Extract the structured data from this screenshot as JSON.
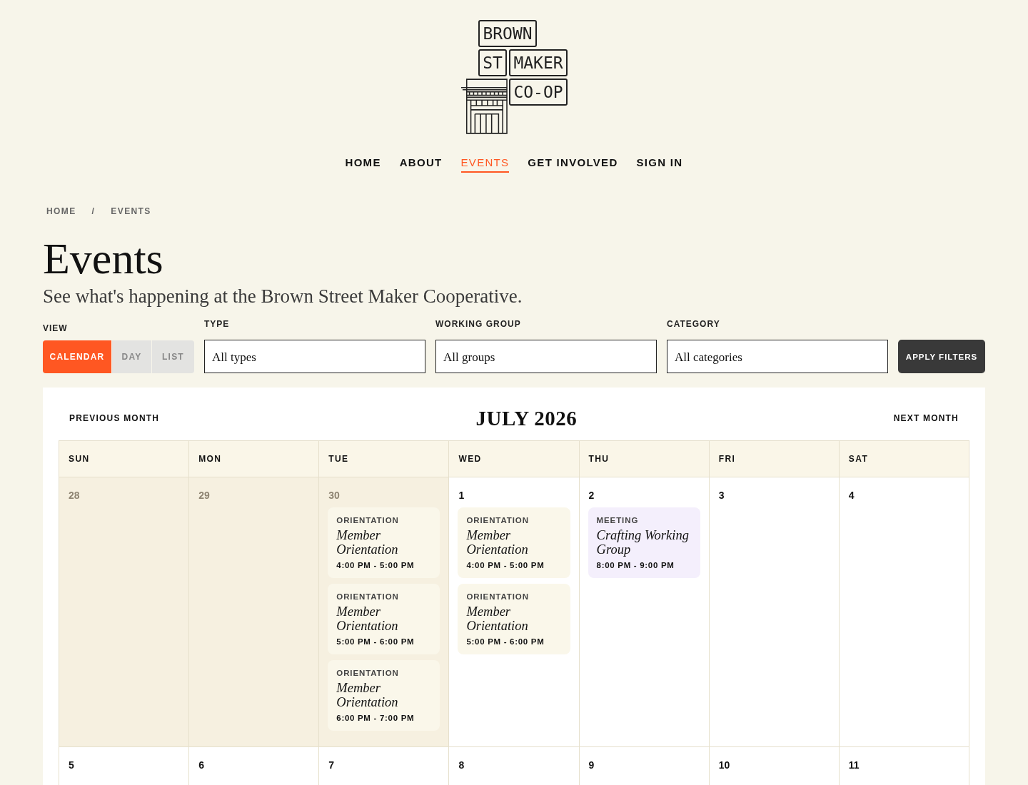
{
  "logo": {
    "words": [
      "BROWN",
      "ST",
      "MAKER",
      "CO-OP"
    ]
  },
  "nav": [
    {
      "label": "HOME",
      "selected": false
    },
    {
      "label": "ABOUT",
      "selected": false
    },
    {
      "label": "EVENTS",
      "selected": true
    },
    {
      "label": "GET INVOLVED",
      "selected": false
    },
    {
      "label": "SIGN IN",
      "selected": false
    }
  ],
  "breadcrumb": {
    "items": [
      "HOME",
      "EVENTS"
    ],
    "separator": "/"
  },
  "page": {
    "title": "Events",
    "subtitle": "See what's happening at the Brown Street Maker Cooperative."
  },
  "filters": {
    "view": {
      "label": "VIEW",
      "options": [
        {
          "label": "CALENDAR",
          "selected": true
        },
        {
          "label": "DAY",
          "selected": false
        },
        {
          "label": "LIST",
          "selected": false
        }
      ]
    },
    "selects": [
      {
        "label": "TYPE",
        "value": "All types"
      },
      {
        "label": "WORKING GROUP",
        "value": "All groups"
      },
      {
        "label": "CATEGORY",
        "value": "All categories"
      }
    ],
    "apply_button": "APPLY FILTERS"
  },
  "calendar": {
    "previous": "PREVIOUS MONTH",
    "title": "JULY 2026",
    "next": "NEXT MONTH",
    "weekdays": [
      "SUN",
      "MON",
      "TUE",
      "WED",
      "THU",
      "FRI",
      "SAT"
    ],
    "weeks": [
      {
        "days": [
          {
            "number": "28",
            "other_month": true
          },
          {
            "number": "29",
            "other_month": true
          },
          {
            "number": "30",
            "other_month": true,
            "events": [
              {
                "category": "ORIENTATION",
                "title": "Member Orientation",
                "time": "4:00 PM - 5:00 PM",
                "color": "#faf7ea"
              },
              {
                "category": "ORIENTATION",
                "title": "Member Orientation",
                "time": "5:00 PM - 6:00 PM",
                "color": "#faf7ea"
              },
              {
                "category": "ORIENTATION",
                "title": "Member Orientation",
                "time": "6:00 PM - 7:00 PM",
                "color": "#faf7ea"
              }
            ]
          },
          {
            "number": "1",
            "other_month": false,
            "events": [
              {
                "category": "ORIENTATION",
                "title": "Member Orientation",
                "time": "4:00 PM - 5:00 PM",
                "color": "#faf7ea"
              },
              {
                "category": "ORIENTATION",
                "title": "Member Orientation",
                "time": "5:00 PM - 6:00 PM",
                "color": "#faf7ea"
              }
            ]
          },
          {
            "number": "2",
            "other_month": false,
            "events": [
              {
                "category": "MEETING",
                "title": "Crafting Working Group",
                "time": "8:00 PM - 9:00 PM",
                "color": "#f4effc"
              }
            ]
          },
          {
            "number": "3",
            "other_month": false
          },
          {
            "number": "4",
            "other_month": false
          }
        ]
      },
      {
        "days": [
          {
            "number": "5",
            "other_month": false
          },
          {
            "number": "6",
            "other_month": false
          },
          {
            "number": "7",
            "other_month": false
          },
          {
            "number": "8",
            "other_month": false
          },
          {
            "number": "9",
            "other_month": false
          },
          {
            "number": "10",
            "other_month": false
          },
          {
            "number": "11",
            "other_month": false
          }
        ]
      }
    ]
  }
}
